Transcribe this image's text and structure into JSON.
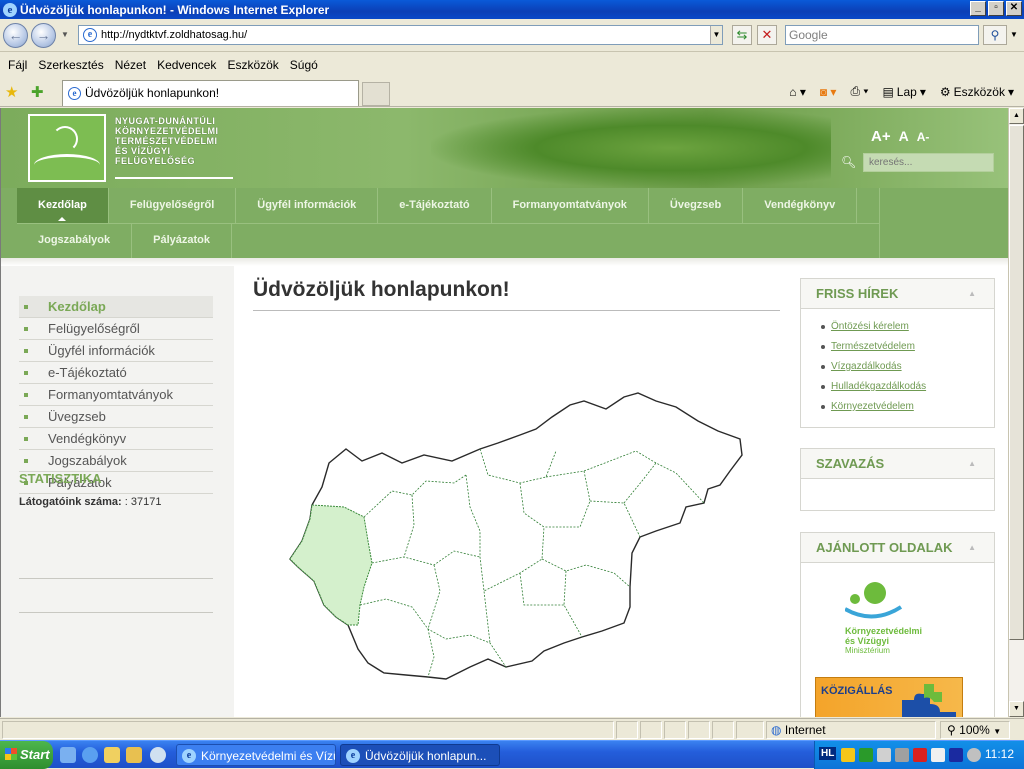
{
  "window": {
    "title": "Üdvözöljük honlapunkon! - Windows Internet Explorer",
    "buttons": [
      "_",
      "▫",
      "✕"
    ]
  },
  "address": {
    "url": "http://nydtktvf.zoldhatosag.hu/",
    "search_placeholder": "Google"
  },
  "menu": [
    "Fájl",
    "Szerkesztés",
    "Nézet",
    "Kedvencek",
    "Eszközök",
    "Súgó"
  ],
  "tab": {
    "label": "Üdvözöljük honlapunkon!"
  },
  "commandbar": {
    "lap": "Lap",
    "eszkozok": "Eszközök"
  },
  "site": {
    "logo_text": "NYUGAT-DUNÁNTÚLI\nKÖRNYEZETVÉDELMI\nTERMÉSZETVÉDELMI\nÉS VÍZÜGYI\nFELÜGYELŐSÉG",
    "font_sizes": [
      "A+",
      "A",
      "A-"
    ],
    "search_placeholder": "keresés...",
    "nav_row1": [
      "Kezdőlap",
      "Felügyelőségről",
      "Ügyfél információk",
      "e-Tájékoztató",
      "Formanyomtatványok",
      "Üvegzseb",
      "Vendégkönyv"
    ],
    "nav_row2": [
      "Jogszabályok",
      "Pályázatok"
    ],
    "sidebar": [
      "Kezdőlap",
      "Felügyelőségről",
      "Ügyfél információk",
      "e-Tájékoztató",
      "Formanyomtatványok",
      "Üvegzseb",
      "Vendégkönyv",
      "Jogszabályok",
      "Pályázatok"
    ],
    "stat_title": "STATISZTIKA",
    "stat_label": "Látogatóink száma:",
    "stat_value": ": 37171",
    "page_title": "Üdvözöljük honlapunkon!",
    "news_title": "FRISS HÍREK",
    "news": [
      "Öntözési kérelem",
      "Természetvédelem",
      "Vízgazdálkodás",
      "Hulladékgazdálkodás",
      "Környezetvédelem"
    ],
    "vote_title": "SZAVAZÁS",
    "recommended_title": "AJÁNLOTT OLDALAK",
    "ministry_text": "Környezetvédelmi\nés Vízügyi",
    "ministry_sub": "Minisztérium",
    "kozig": "KÖZIGÁLLÁS"
  },
  "status": {
    "zone": "Internet",
    "zoom": "100%"
  },
  "taskbar": {
    "start": "Start",
    "buttons": [
      "Környezetvédelmi és Vízü...",
      "Üdvözöljük honlapun..."
    ],
    "tray_hl": "HL",
    "clock": "11:12"
  },
  "colors": {
    "brand_green": "#7fad63",
    "nav_active": "#5f8e44",
    "link_green": "#6f9a52",
    "map_highlight": "#d4f0cc"
  }
}
